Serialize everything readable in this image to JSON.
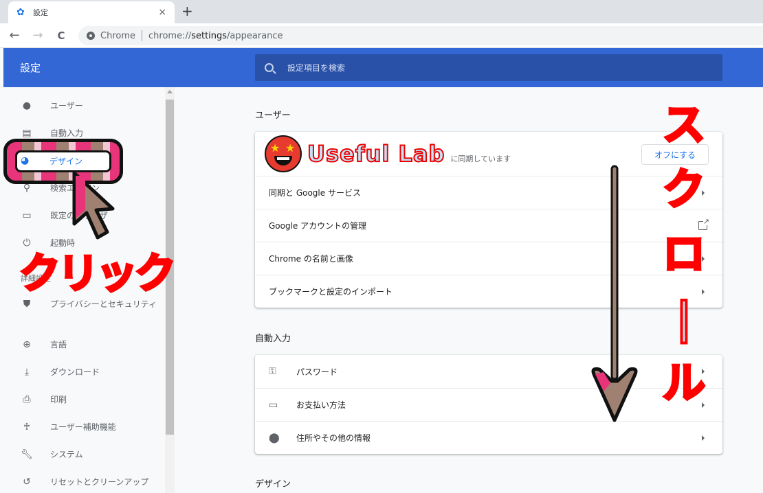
{
  "browser": {
    "tab": {
      "title": "設定",
      "icon": "gear-icon"
    },
    "new_tab": "+",
    "close": "×",
    "nav": {
      "back": "←",
      "forward": "→",
      "reload": "C"
    },
    "omnibox": {
      "chip": "Chrome",
      "url_prefix": "chrome://",
      "url_host": "settings",
      "url_path": "/appearance"
    }
  },
  "header": {
    "title": "設定",
    "search_placeholder": "設定項目を検索"
  },
  "sidebar": {
    "items": [
      {
        "label": "ユーザー",
        "icon": "person-icon"
      },
      {
        "label": "自動入力",
        "icon": "clipboard-icon"
      },
      {
        "label": "デザイン",
        "icon": "palette-icon",
        "active": true
      },
      {
        "label": "検索エンジン",
        "icon": "search-icon"
      },
      {
        "label": "既定のブラウザ",
        "icon": "browser-icon"
      },
      {
        "label": "起動時",
        "icon": "power-icon"
      }
    ],
    "advanced_label": "詳細設定",
    "advanced_items": [
      {
        "label": "プライバシーとセキュリティ",
        "icon": "shield-icon"
      },
      {
        "label": "言語",
        "icon": "globe-icon"
      },
      {
        "label": "ダウンロード",
        "icon": "download-icon"
      },
      {
        "label": "印刷",
        "icon": "printer-icon"
      },
      {
        "label": "ユーザー補助機能",
        "icon": "accessibility-icon"
      },
      {
        "label": "システム",
        "icon": "wrench-icon"
      },
      {
        "label": "リセットとクリーンアップ",
        "icon": "history-icon"
      }
    ]
  },
  "main": {
    "users": {
      "heading": "ユーザー",
      "profile_name": "Useful Lab",
      "sync_text": "に同期しています",
      "off_button": "オフにする",
      "rows": [
        "同期と Google サービス",
        "Google アカウントの管理",
        "Chrome の名前と画像",
        "ブックマークと設定のインポート"
      ]
    },
    "autofill": {
      "heading": "自動入力",
      "rows": [
        "パスワード",
        "お支払い方法",
        "住所やその他の情報"
      ]
    },
    "design": {
      "heading": "デザイン"
    }
  },
  "annotations": {
    "click": "クリック",
    "scroll": [
      "ス",
      "ク",
      "ロ",
      "|",
      "ル"
    ]
  }
}
